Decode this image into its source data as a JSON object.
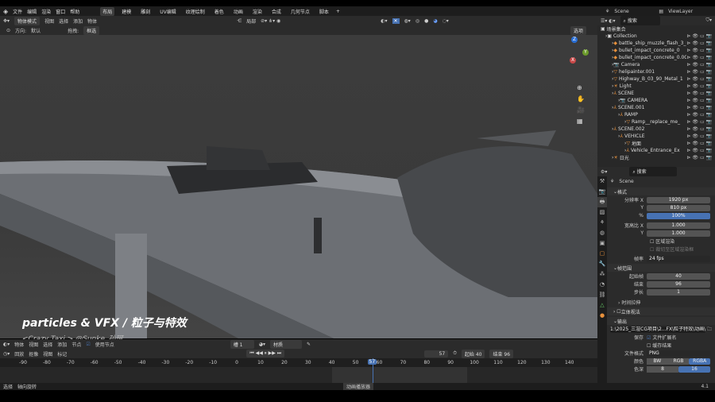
{
  "menu": {
    "items": [
      "文件",
      "编辑",
      "渲染",
      "窗口",
      "帮助"
    ],
    "workspaces": [
      "布局",
      "建模",
      "雕刻",
      "UV编辑",
      "纹理绘制",
      "着色",
      "动画",
      "渲染",
      "合成",
      "几何节点",
      "脚本"
    ],
    "active_workspace": "布局",
    "add": "+"
  },
  "topright": {
    "scene": "Scene",
    "view_layer": "ViewLayer"
  },
  "header": {
    "mode": "物体模式",
    "menus": [
      "视图",
      "选择",
      "添加",
      "物体"
    ],
    "pivot": "局部",
    "overlay": "选项"
  },
  "tool": {
    "orientation_label": "方向:",
    "orientation": "默认",
    "snap_label": "拖拽:",
    "snap": "框选"
  },
  "viewport": {
    "caption": "particles & VFX / 粒子与特效",
    "watermark": "<Crazy Taxi >  @Sunke_孙珂",
    "gizmo": {
      "z": "Z",
      "y": "Y",
      "x": "X"
    }
  },
  "outliner": {
    "search_placeholder": "搜索",
    "root": "场景集合",
    "items": [
      {
        "name": "Collection",
        "depth": 0,
        "icon": "collection"
      },
      {
        "name": "battle_ship_muzzle_flash_3_I",
        "depth": 1,
        "icon": "object"
      },
      {
        "name": "bullet_impact_concrete_0",
        "depth": 1,
        "icon": "object"
      },
      {
        "name": "bullet_impact_concrete_0.0C",
        "depth": 1,
        "icon": "object"
      },
      {
        "name": "Camera",
        "depth": 1,
        "icon": "camera"
      },
      {
        "name": "helipainter.001",
        "depth": 1,
        "icon": "mesh"
      },
      {
        "name": "Highway_B_03_90_Metal_1",
        "depth": 1,
        "icon": "mesh"
      },
      {
        "name": "Light",
        "depth": 1,
        "icon": "light"
      },
      {
        "name": "SCENE",
        "depth": 1,
        "icon": "empty"
      },
      {
        "name": "CAMERA",
        "depth": 2,
        "icon": "camera"
      },
      {
        "name": "SCENE.001",
        "depth": 1,
        "icon": "empty"
      },
      {
        "name": "RAMP",
        "depth": 2,
        "icon": "empty"
      },
      {
        "name": "Ramp__replace_me_",
        "depth": 3,
        "icon": "mesh"
      },
      {
        "name": "SCENE.002",
        "depth": 1,
        "icon": "empty"
      },
      {
        "name": "VEHICLE",
        "depth": 2,
        "icon": "empty"
      },
      {
        "name": "地面",
        "depth": 3,
        "icon": "mesh"
      },
      {
        "name": "Vehicle_Entrance_Ex",
        "depth": 3,
        "icon": "empty"
      },
      {
        "name": "日光",
        "depth": 1,
        "icon": "light"
      }
    ]
  },
  "props": {
    "search_placeholder": "搜索",
    "context": "Scene",
    "format": {
      "title": "格式",
      "res_x_label": "分辨率 X",
      "res_x": "1920 px",
      "res_y_label": "Y",
      "res_y": "810 px",
      "pct_label": "%",
      "pct": "100%",
      "aspect_x_label": "宽高比 X",
      "aspect_x": "1.000",
      "aspect_y_label": "Y",
      "aspect_y": "1.000",
      "region": "区域渲染",
      "crop": "裁切至区域渲染框",
      "fps_label": "帧率",
      "fps": "24 fps"
    },
    "range": {
      "title": "帧范围",
      "start_label": "起始帧",
      "start": "40",
      "end_label": "结束",
      "end": "96",
      "step_label": "步长",
      "step": "1"
    },
    "time_stretch": "时间拉伸",
    "stereo": "立体视法",
    "output": {
      "title": "输出",
      "path": "1:\\2025_三渲CG项目\\2...FX\\粒子特效\\动画\\",
      "save_label": "保存",
      "file_ext": "文件扩展名",
      "cache": "缓存结果",
      "format_label": "文件格式",
      "format": "PNG",
      "color_label": "颜色",
      "color_opts": [
        "BW",
        "RGB",
        "RGBA"
      ],
      "color_sel": "RGBA",
      "depth_label": "色深",
      "depth_opts": [
        "8",
        "16"
      ],
      "depth_sel": "16"
    }
  },
  "node_header": {
    "type": "物体",
    "menus": [
      "视图",
      "选择",
      "添加",
      "节点"
    ],
    "use_nodes": "使用节点",
    "slot": "槽 1",
    "material": "材质"
  },
  "timeline": {
    "menus": [
      "回放",
      "抠像",
      "视图",
      "标记"
    ],
    "current_frame": 57,
    "start_label": "起始",
    "start": 40,
    "end_label": "结束",
    "end": 96,
    "ticks": [
      -90,
      -80,
      -70,
      -60,
      -50,
      -40,
      -30,
      -20,
      -10,
      0,
      10,
      20,
      30,
      40,
      50,
      60,
      70,
      80,
      90,
      100,
      110,
      120,
      130,
      140
    ]
  },
  "status": {
    "items": [
      "选择",
      "轴向旋转"
    ],
    "center": "动画播放器",
    "version": "4.1"
  }
}
